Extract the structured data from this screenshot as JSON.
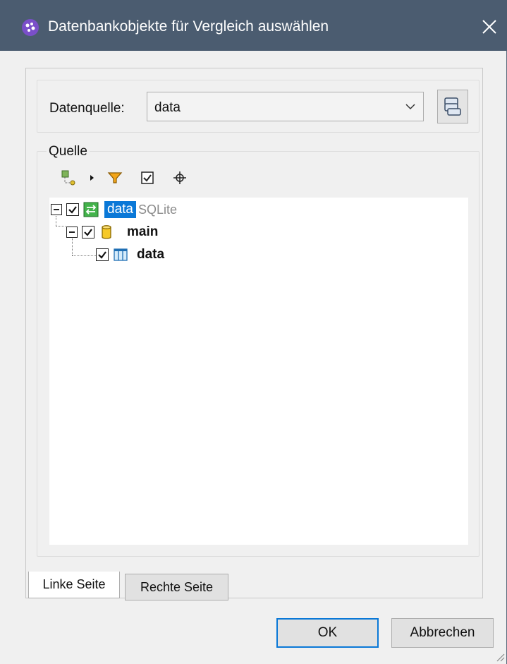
{
  "window": {
    "title": "Datenbankobjekte für Vergleich auswählen",
    "icon": "app-logo-icon",
    "close_icon": "close-icon"
  },
  "datasource": {
    "label": "Datenquelle:",
    "selected": "data",
    "button_icon": "data-source-icon"
  },
  "source_group": {
    "label": "Quelle",
    "toolbar": [
      "add-filter-icon",
      "dropdown-arrow-icon",
      "filter-icon",
      "checkbox-icon",
      "locate-icon"
    ]
  },
  "tree": [
    {
      "label": "data",
      "sublabel": "SQLite",
      "icon": "database-connection-icon",
      "checked": true,
      "selected": true,
      "level": 0
    },
    {
      "label": "main",
      "icon": "schema-cylinder-icon",
      "checked": true,
      "selected": false,
      "level": 1
    },
    {
      "label": "data",
      "icon": "table-icon",
      "checked": true,
      "selected": false,
      "level": 2
    }
  ],
  "tabs": {
    "left": "Linke Seite",
    "right": "Rechte Seite"
  },
  "buttons": {
    "ok": "OK",
    "cancel": "Abbrechen"
  },
  "colors": {
    "titlebar": "#4b5c70",
    "selection": "#0a78d7"
  }
}
